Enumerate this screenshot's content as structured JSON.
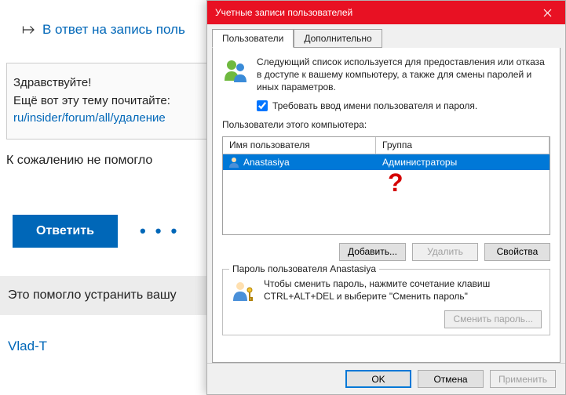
{
  "forum": {
    "reply_link_text": "В ответ на запись поль",
    "post_greeting": "Здравствуйте!",
    "post_advice": "Ещё вот эту тему почитайте:",
    "post_link_text": "ru/insider/forum/all/удаление",
    "reply_result": "К сожалению не помогло",
    "reply_button": "Ответить",
    "more": "• • •",
    "helpful_line": "Это помогло устранить вашу",
    "username": "Vlad-T"
  },
  "dialog": {
    "title": "Учетные записи пользователей",
    "tabs": {
      "users": "Пользователи",
      "advanced": "Дополнительно"
    },
    "description": "Следующий список используется для предоставления или отказа в доступе к вашему компьютеру, а также для смены паролей и иных параметров.",
    "require_login_label": "Требовать ввод имени пользователя и пароля.",
    "users_of_computer": "Пользователи этого компьютера:",
    "col_user": "Имя пользователя",
    "col_group": "Группа",
    "row": {
      "user": "Anastasiya",
      "group": "Администраторы"
    },
    "question_mark": "?",
    "btn_add": "Добавить...",
    "btn_remove": "Удалить",
    "btn_props": "Свойства",
    "pw_group_title": "Пароль пользователя Anastasiya",
    "pw_text": "Чтобы сменить пароль, нажмите сочетание клавиш CTRL+ALT+DEL и выберите \"Сменить пароль\"",
    "btn_change_pw": "Сменить пароль...",
    "btn_ok": "OK",
    "btn_cancel": "Отмена",
    "btn_apply": "Применить"
  }
}
